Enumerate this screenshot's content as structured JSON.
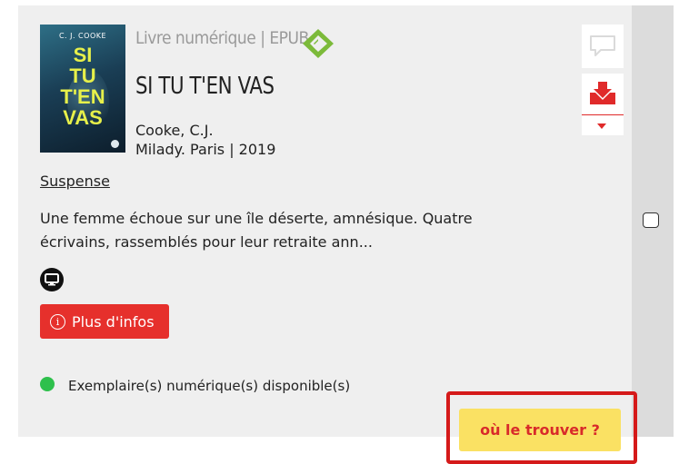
{
  "cover": {
    "author": "C. J. COOKE",
    "title": "SI\nTU\nT'EN\nVAS"
  },
  "record": {
    "format": "Livre numérique | EPUB",
    "title": "SI TU T'EN VAS",
    "author": "Cooke, C.J.",
    "publication": "Milady. Paris | 2019",
    "genre": "Suspense",
    "summary": "Une femme échoue sur une île déserte, amnésique. Quatre écrivains, rassemblés pour leur retraite ann...",
    "more_info_label": "Plus d'infos",
    "availability": "Exemplaire(s) numérique(s) disponible(s)",
    "where_label": "où le trouver ?"
  },
  "colors": {
    "accent_red": "#e6302c",
    "where_button": "#fae163",
    "available_dot": "#2ec04c",
    "epub_green": "#7cba3a",
    "highlight_frame": "#d51a1a"
  },
  "icons": {
    "epub": "epub-logo-icon",
    "screen": "screen-icon",
    "info": "info-icon",
    "comment": "comment-icon",
    "download": "download-icon",
    "dropdown": "caret-down-icon"
  }
}
